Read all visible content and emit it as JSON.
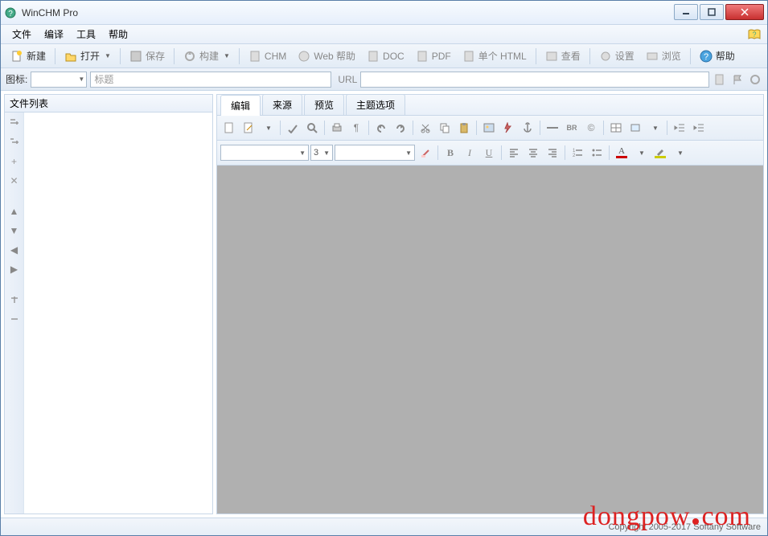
{
  "title": "WinCHM Pro",
  "menu": {
    "file": "文件",
    "compile": "编译",
    "tools": "工具",
    "help": "帮助"
  },
  "tb1": {
    "new": "新建",
    "open": "打开",
    "save": "保存",
    "build": "构建",
    "chm": "CHM",
    "webhelp": "Web 帮助",
    "doc": "DOC",
    "pdf": "PDF",
    "single": "单个 HTML",
    "view": "查看",
    "settings": "设置",
    "browse": "浏览",
    "help": "帮助"
  },
  "tb2": {
    "icon_label": "图标:",
    "title_label": "标题",
    "url_label": "URL"
  },
  "left": {
    "header": "文件列表"
  },
  "tabs": {
    "edit": "编辑",
    "source": "来源",
    "preview": "预览",
    "theme": "主题选项"
  },
  "fontsize": "3",
  "status": "Copyright 2005-2017 Softany Software",
  "watermark": {
    "a": "dongpow",
    "b": "com"
  }
}
